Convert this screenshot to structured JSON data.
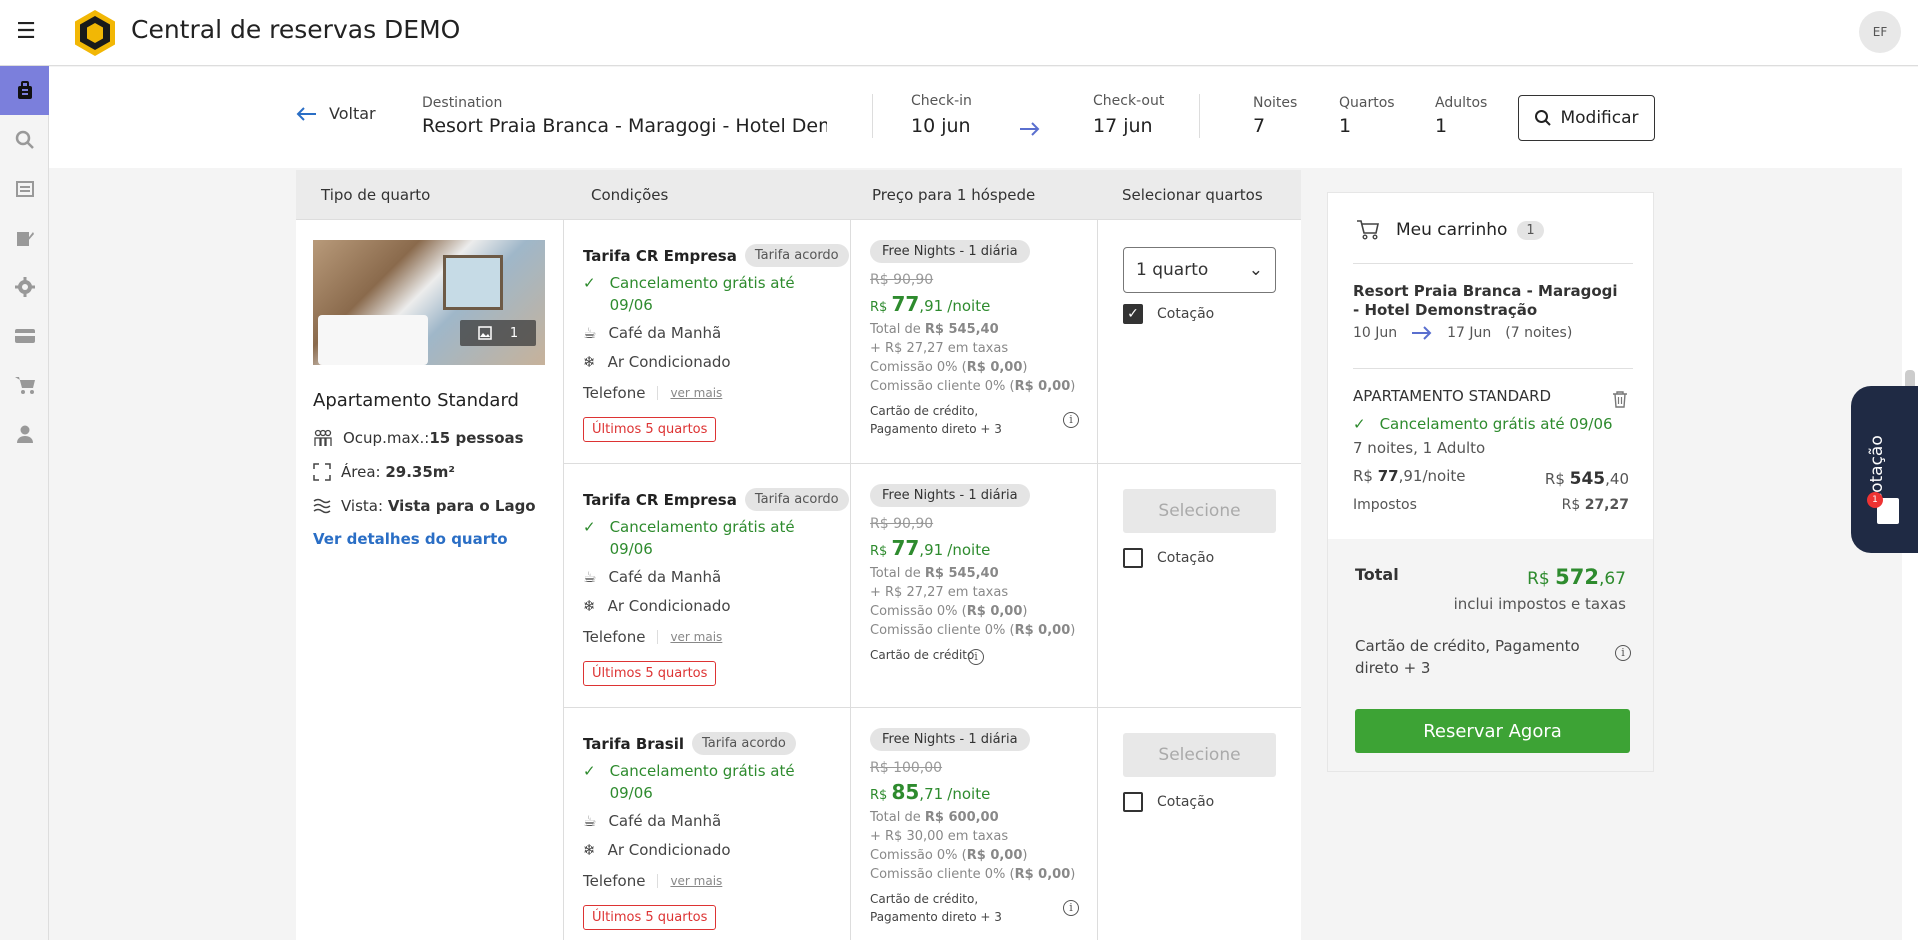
{
  "app": {
    "title": "Central de reservas DEMO",
    "user_initials": "EF"
  },
  "colors": {
    "accent": "#7b7fdc",
    "green": "#2e8b2e",
    "brand_yellow": "#f2b705",
    "cta": "#3da335"
  },
  "search": {
    "back_label": "Voltar",
    "destination_label": "Destination",
    "destination_value": "Resort Praia Branca - Maragogi - Hotel Demonstração",
    "checkin_label": "Check-in",
    "checkin_value": "10 jun",
    "checkout_label": "Check-out",
    "checkout_value": "17 jun",
    "nights_label": "Noites",
    "nights_value": "7",
    "rooms_label": "Quartos",
    "rooms_value": "1",
    "adults_label": "Adultos",
    "adults_value": "1",
    "modify_label": "Modificar"
  },
  "table": {
    "headers": [
      "Tipo de quarto",
      "Condições",
      "Preço para 1 hóspede",
      "Selecionar quartos"
    ],
    "room": {
      "image_count": "1",
      "name": "Apartamento Standard",
      "occupancy_label": "Ocup.max.:",
      "occupancy_value": "15 pessoas",
      "area_label": "Área:",
      "area_value": "29.35m²",
      "view_label": "Vista:",
      "view_value": "Vista para o Lago",
      "details_link": "Ver detalhes do quarto"
    },
    "rates": [
      {
        "name": "Tarifa CR Empresa",
        "badge": "Tarifa acordo",
        "cancel": "Cancelamento grátis até 09/06",
        "breakfast": "Café da Manhã",
        "ac": "Ar Condicionado",
        "phone": "Telefone",
        "ver_mais": "ver mais",
        "scarcity": "Últimos 5 quartos",
        "promo": "Free Nights - 1 diária",
        "old_price": "R$ 90,90",
        "currency": "R$",
        "price_int": "77",
        "price_dec": ",91",
        "per_night": "/noite",
        "total_label": "Total de",
        "total_value": "R$ 545,40",
        "taxes": "+ R$ 27,27 em taxas",
        "commission": "Comissão 0% (",
        "commission_value": "R$ 0,00",
        "commission_close": ")",
        "client_commission": "Comissão cliente 0% (",
        "client_commission_value": "R$ 0,00",
        "client_commission_close": ")",
        "payment": "Cartão de crédito, Pagamento direto + 3",
        "quantity": "1 quarto",
        "quote_label": "Cotação",
        "quote_checked": true
      },
      {
        "name": "Tarifa CR Empresa",
        "badge": "Tarifa acordo",
        "cancel": "Cancelamento grátis até 09/06",
        "breakfast": "Café da Manhã",
        "ac": "Ar Condicionado",
        "phone": "Telefone",
        "ver_mais": "ver mais",
        "scarcity": "Últimos 5 quartos",
        "promo": "Free Nights - 1 diária",
        "old_price": "R$ 90,90",
        "currency": "R$",
        "price_int": "77",
        "price_dec": ",91",
        "per_night": "/noite",
        "total_label": "Total de",
        "total_value": "R$ 545,40",
        "taxes": "+ R$ 27,27 em taxas",
        "commission": "Comissão 0% (",
        "commission_value": "R$ 0,00",
        "commission_close": ")",
        "client_commission": "Comissão cliente 0% (",
        "client_commission_value": "R$ 0,00",
        "client_commission_close": ")",
        "payment": "Cartão de crédito",
        "select_label": "Selecione",
        "quote_label": "Cotação",
        "quote_checked": false
      },
      {
        "name": "Tarifa Brasil",
        "badge": "Tarifa acordo",
        "cancel": "Cancelamento grátis até 09/06",
        "breakfast": "Café da Manhã",
        "ac": "Ar Condicionado",
        "phone": "Telefone",
        "ver_mais": "ver mais",
        "scarcity": "Últimos 5 quartos",
        "promo": "Free Nights - 1 diária",
        "old_price": "R$ 100,00",
        "currency": "R$",
        "price_int": "85",
        "price_dec": ",71",
        "per_night": "/noite",
        "total_label": "Total de",
        "total_value": "R$ 600,00",
        "taxes": "+ R$ 30,00 em taxas",
        "commission": "Comissão 0% (",
        "commission_value": "R$ 0,00",
        "commission_close": ")",
        "client_commission": "Comissão cliente 0% (",
        "client_commission_value": "R$ 0,00",
        "client_commission_close": ")",
        "payment": "Cartão de crédito, Pagamento direto + 3",
        "select_label": "Selecione",
        "quote_label": "Cotação",
        "quote_checked": false
      }
    ]
  },
  "cart": {
    "title": "Meu carrinho",
    "count": "1",
    "hotel": "Resort Praia Branca - Maragogi - Hotel Demonstração",
    "date_from": "10 Jun",
    "date_to": "17 Jun",
    "nights": "(7 noites)",
    "room": "APARTAMENTO STANDARD",
    "cancel": "Cancelamento grátis até 09/06",
    "guests": "7 noites, 1 Adulto",
    "per_night_currency": "R$",
    "per_night_int": "77",
    "per_night_dec": ",91",
    "per_night_suffix": "/noite",
    "subtotal_currency": "R$",
    "subtotal_int": "545",
    "subtotal_dec": ",40",
    "taxes_label": "Impostos",
    "taxes_currency": "R$",
    "taxes_value": "27,27",
    "total_label": "Total",
    "total_currency": "R$",
    "total_int": "572",
    "total_dec": ",67",
    "total_note": "inclui impostos e taxas",
    "payment": "Cartão de crédito, Pagamento direto + 3",
    "cta": "Reservar Agora"
  },
  "quote_tab": {
    "label": "Cotação",
    "badge": "1"
  }
}
